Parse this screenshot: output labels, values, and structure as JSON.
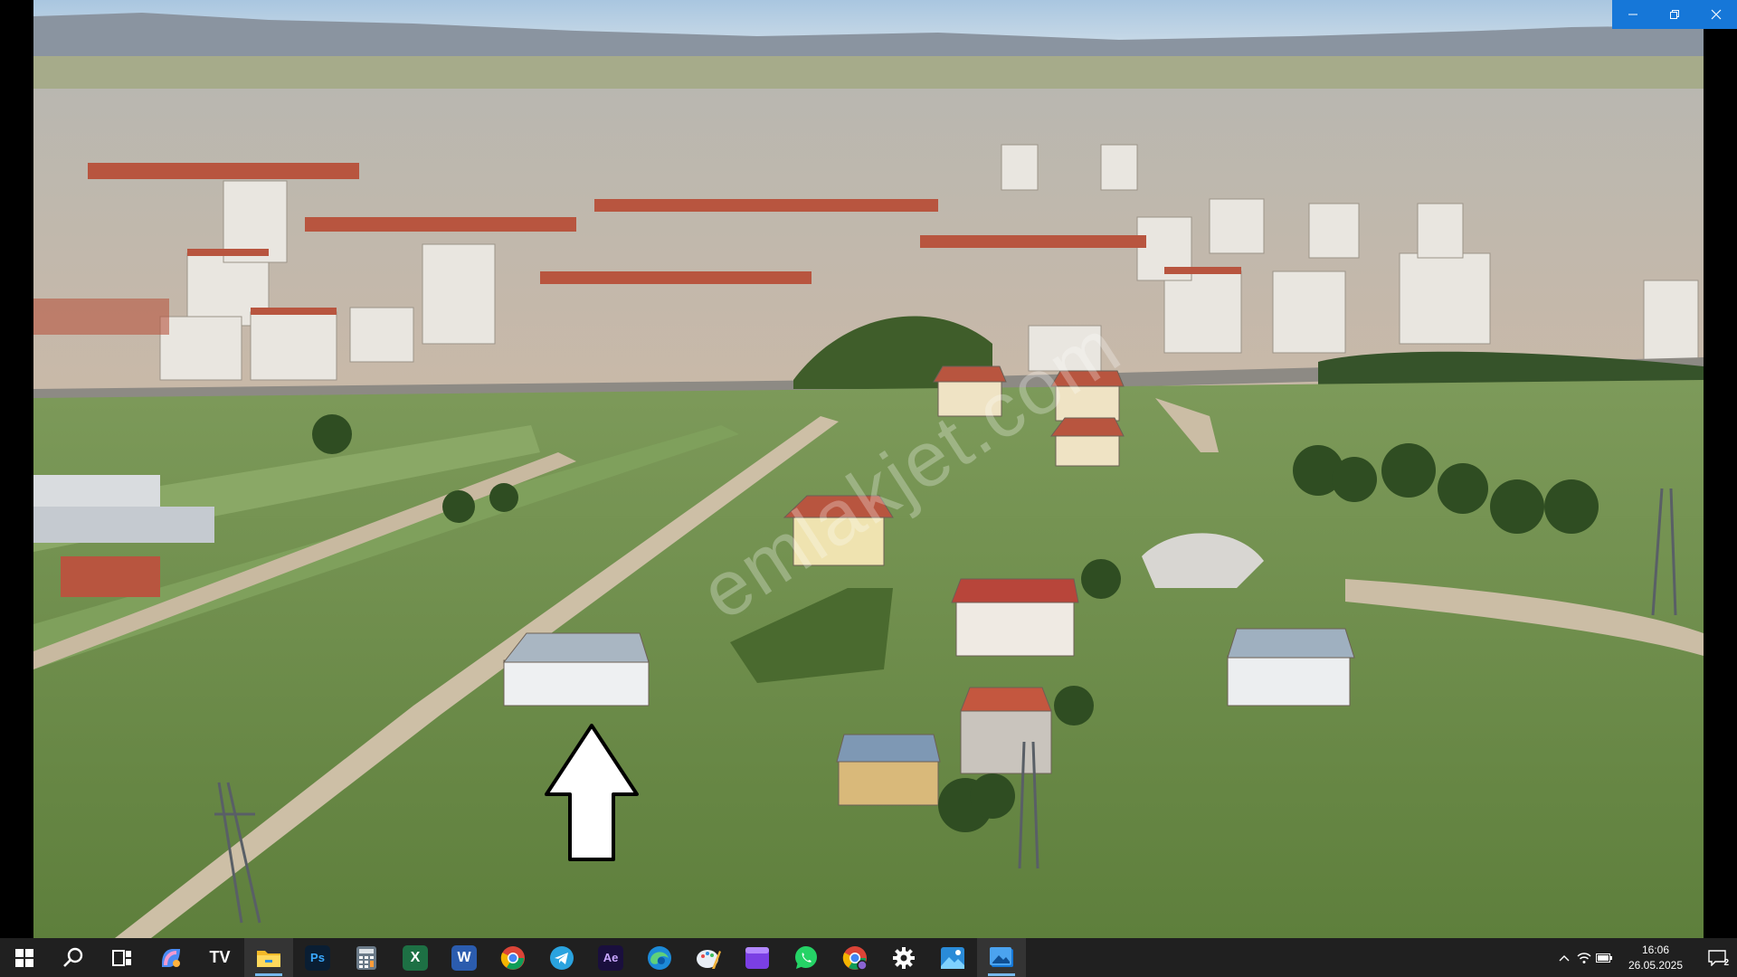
{
  "photo": {
    "description_icons": "aerial-photo",
    "watermark": "emlakjet.com"
  },
  "window_controls": {
    "minimize_icon": "minimize-icon",
    "restore_icon": "restore-icon",
    "close_icon": "close-icon",
    "accent": "#1677d8"
  },
  "taskbar": {
    "apps": [
      {
        "name": "start-icon"
      },
      {
        "name": "search-icon"
      },
      {
        "name": "task-view-icon"
      },
      {
        "name": "copilot-icon"
      },
      {
        "name": "tradingview-icon",
        "label": "TV"
      },
      {
        "name": "file-explorer-icon"
      },
      {
        "name": "photoshop-icon",
        "label": "Ps"
      },
      {
        "name": "calculator-icon"
      },
      {
        "name": "excel-icon",
        "label": "X"
      },
      {
        "name": "word-icon",
        "label": "W"
      },
      {
        "name": "chrome-icon"
      },
      {
        "name": "telegram-icon"
      },
      {
        "name": "after-effects-icon",
        "label": "Ae"
      },
      {
        "name": "edge-icon"
      },
      {
        "name": "paint-icon"
      },
      {
        "name": "clipchamp-icon"
      },
      {
        "name": "whatsapp-icon"
      },
      {
        "name": "chrome-profile-icon"
      },
      {
        "name": "settings-icon"
      },
      {
        "name": "photos-icon"
      },
      {
        "name": "photo-viewer-icon"
      }
    ],
    "tray": {
      "time": "16:06",
      "date": "26.05.2025",
      "notification_count": "2"
    }
  }
}
